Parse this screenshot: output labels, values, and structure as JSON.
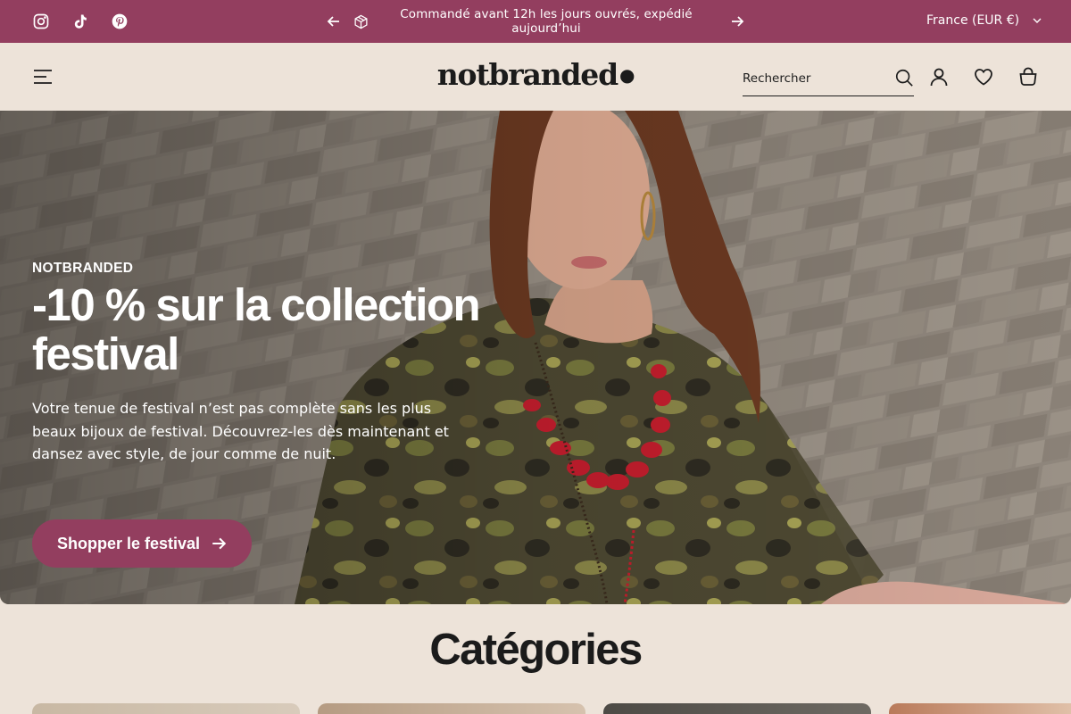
{
  "announcement": {
    "text": "Commandé avant 12h les jours ouvrés, expédié aujourd’hui",
    "social": [
      "instagram-icon",
      "tiktok-icon",
      "pinterest-icon"
    ],
    "locale": "France (EUR €)"
  },
  "header": {
    "logo": "notbranded",
    "search_placeholder": "Rechercher"
  },
  "hero": {
    "eyebrow": "NOTBRANDED",
    "title": "-10 % sur la collection festival",
    "text": "Votre tenue de festival n’est pas complète sans les plus beaux bijoux de festival. Découvrez-les dès maintenant et dansez avec style, de jour comme de nuit.",
    "button": "Shopper le festival"
  },
  "categories": {
    "title": "Catégories"
  },
  "colors": {
    "accent": "#933e5f",
    "background": "#ede3d9",
    "text": "#1c1c1c"
  }
}
